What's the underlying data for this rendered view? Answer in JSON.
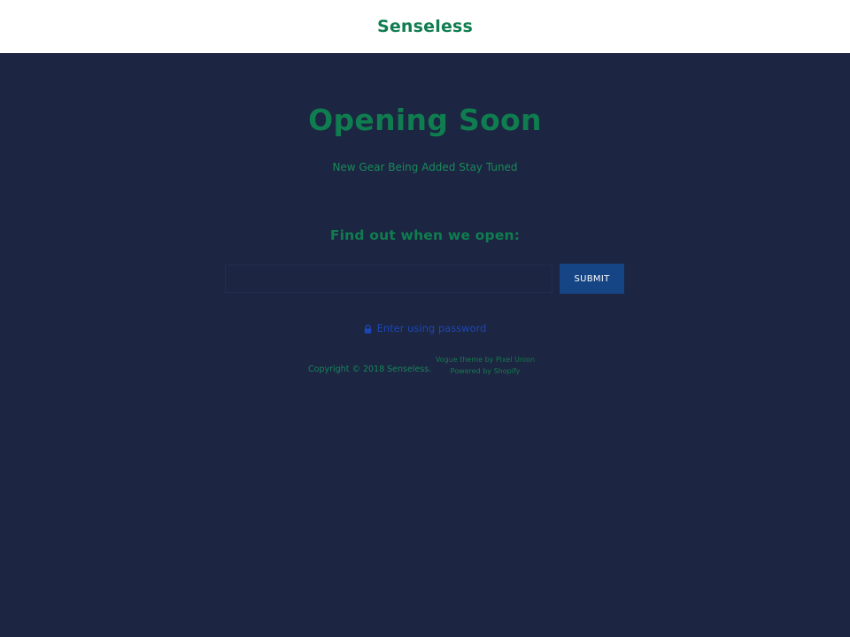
{
  "header": {
    "brand": "Senseless"
  },
  "main": {
    "title": "Opening Soon",
    "subtitle": "New Gear Being Added Stay Tuned",
    "signup_heading": "Find out when we open:",
    "email_placeholder": "",
    "submit_label": "SUBMIT",
    "password_link": "Enter using password",
    "password_icon": "lock-icon"
  },
  "footer": {
    "copyright": "Copyright © 2018 Senseless.",
    "theme_credit": "Vogue theme by Pixel Union",
    "powered_by": "Powered by Shopify"
  },
  "colors": {
    "background": "#1c2541",
    "header_background": "#ffffff",
    "accent_green": "#0f7d4f",
    "button_blue": "#154584",
    "link_blue": "#1d47b8"
  }
}
